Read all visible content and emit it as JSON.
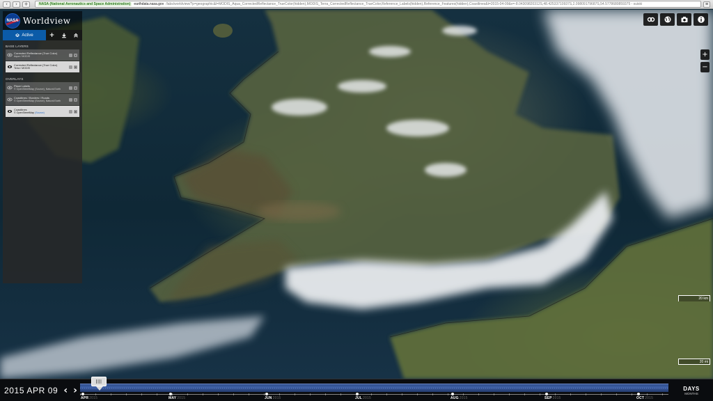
{
  "browser": {
    "ssl_label": "NASA (National Aeronautics and Space Administration)",
    "url_domain": "earthdata.nasa.gov",
    "url_path": "/labs/worldview/?p=geographic&l=MODIS_Aqua_CorrectedReflectance_TrueColor(hidden),MODIS_Terra_CorrectedReflectance_TrueColor,Reference_Labels(hidden),Reference_Features(hidden),Coastlines&t=2015-04-09&v=-8.04309820312S,48.42533710937S,2.09809179687S,54.5778680859375 - suiski",
    "back_icon": "arrow-left-icon",
    "forward_icon": "arrow-right-icon",
    "add_icon": "plus-icon",
    "menu_icon": "hamburger-icon"
  },
  "header": {
    "logo_text": "NASA",
    "title": "Worldview"
  },
  "panel": {
    "tab_active_label": "Active",
    "add_icon": "plus-icon",
    "download_icon": "download-icon",
    "collapse_icon": "chevron-up-icon",
    "base_layers_heading": "BASE LAYERS",
    "overlays_heading": "OVERLAYS",
    "base_layers": [
      {
        "name": "Corrected Reflectance (True Color)",
        "source": "Aqua / MODIS",
        "visible": false,
        "selected": false
      },
      {
        "name": "Corrected Reflectance (True Color)",
        "source": "Terra / MODIS",
        "visible": true,
        "selected": true
      }
    ],
    "overlays": [
      {
        "name": "Place Labels",
        "source": "© OpenStreetMap (Source), Natural Earth",
        "visible": false,
        "selected": false
      },
      {
        "name": "Coastlines / Borders / Roads",
        "source": "© OpenStreetMap (Source), Natural Earth",
        "visible": false,
        "selected": false
      },
      {
        "name": "Coastlines",
        "source_prefix": "© OpenStreetMap ",
        "source_link": "(Source)",
        "visible": true,
        "selected": true
      }
    ]
  },
  "tools": {
    "link_icon": "link-icon",
    "projection_icon": "globe-icon",
    "camera_icon": "camera-icon",
    "info_icon": "info-icon",
    "zoom_in": "+",
    "zoom_out": "−"
  },
  "scale": {
    "top_label": "20 km",
    "bottom_label": "20 mi"
  },
  "timeline": {
    "date": "2015 APR 09",
    "prev_icon": "chevron-left-icon",
    "next_icon": "chevron-right-icon",
    "months": [
      {
        "label": "APR",
        "year": "2015"
      },
      {
        "label": "MAY",
        "year": "2015"
      },
      {
        "label": "JUN",
        "year": "2015"
      },
      {
        "label": "JUL",
        "year": "2015"
      },
      {
        "label": "AUG",
        "year": "2015"
      },
      {
        "label": "SEP",
        "year": "2015"
      },
      {
        "label": "OCT",
        "year": "2015"
      }
    ],
    "zoom_label": "DAYS",
    "zoom_sub": "MONTHS"
  }
}
